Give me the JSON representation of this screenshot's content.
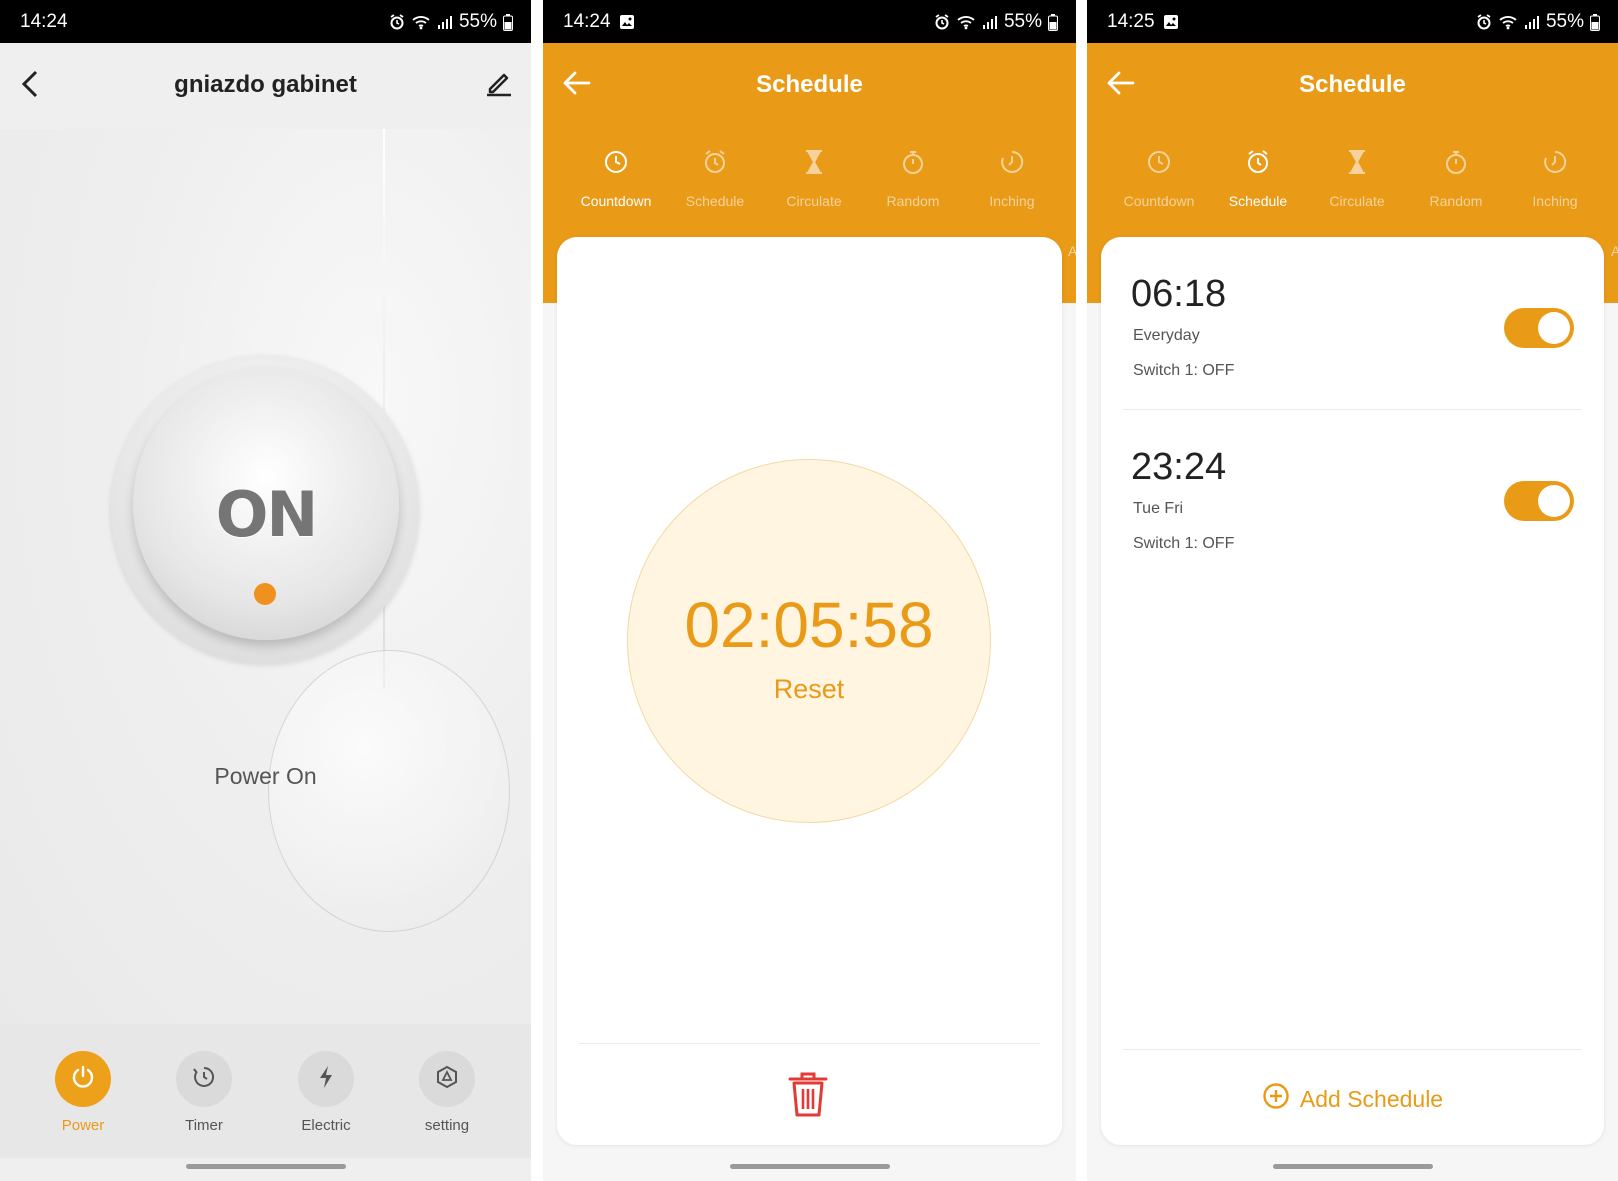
{
  "phone1": {
    "status": {
      "time": "14:24",
      "battery": "55%"
    },
    "title": "gniazdo gabinet",
    "switch_label": "ON",
    "power_state": "Power On",
    "tabs": [
      {
        "label": "Power",
        "icon": "power-icon",
        "active": true
      },
      {
        "label": "Timer",
        "icon": "timer-icon",
        "active": false
      },
      {
        "label": "Electric",
        "icon": "lightning-icon",
        "active": false
      },
      {
        "label": "setting",
        "icon": "gear-icon",
        "active": false
      }
    ]
  },
  "phone2": {
    "status": {
      "time": "14:24",
      "battery": "55%"
    },
    "title": "Schedule",
    "tabs": [
      {
        "label": "Countdown",
        "icon": "clock-icon",
        "active": true
      },
      {
        "label": "Schedule",
        "icon": "alarm-clock-icon",
        "active": false
      },
      {
        "label": "Circulate",
        "icon": "hourglass-icon",
        "active": false
      },
      {
        "label": "Random",
        "icon": "stopwatch-icon",
        "active": false
      },
      {
        "label": "Inching",
        "icon": "inching-clock-icon",
        "active": false
      }
    ],
    "overflow_tab_letter": "A",
    "countdown": {
      "time": "02:05:58",
      "reset_label": "Reset"
    }
  },
  "phone3": {
    "status": {
      "time": "14:25",
      "battery": "55%"
    },
    "title": "Schedule",
    "tabs": [
      {
        "label": "Countdown",
        "icon": "clock-icon",
        "active": false
      },
      {
        "label": "Schedule",
        "icon": "alarm-clock-icon",
        "active": true
      },
      {
        "label": "Circulate",
        "icon": "hourglass-icon",
        "active": false
      },
      {
        "label": "Random",
        "icon": "stopwatch-icon",
        "active": false
      },
      {
        "label": "Inching",
        "icon": "inching-clock-icon",
        "active": false
      }
    ],
    "overflow_tab_letter": "A",
    "schedules": [
      {
        "time": "06:18",
        "repeat": "Everyday",
        "action": "Switch 1: OFF",
        "enabled": true
      },
      {
        "time": "23:24",
        "repeat": "Tue Fri",
        "action": "Switch 1: OFF",
        "enabled": true
      }
    ],
    "add_label": "Add Schedule"
  },
  "colors": {
    "accent": "#e99a17",
    "danger": "#e53935",
    "text": "#222222"
  }
}
